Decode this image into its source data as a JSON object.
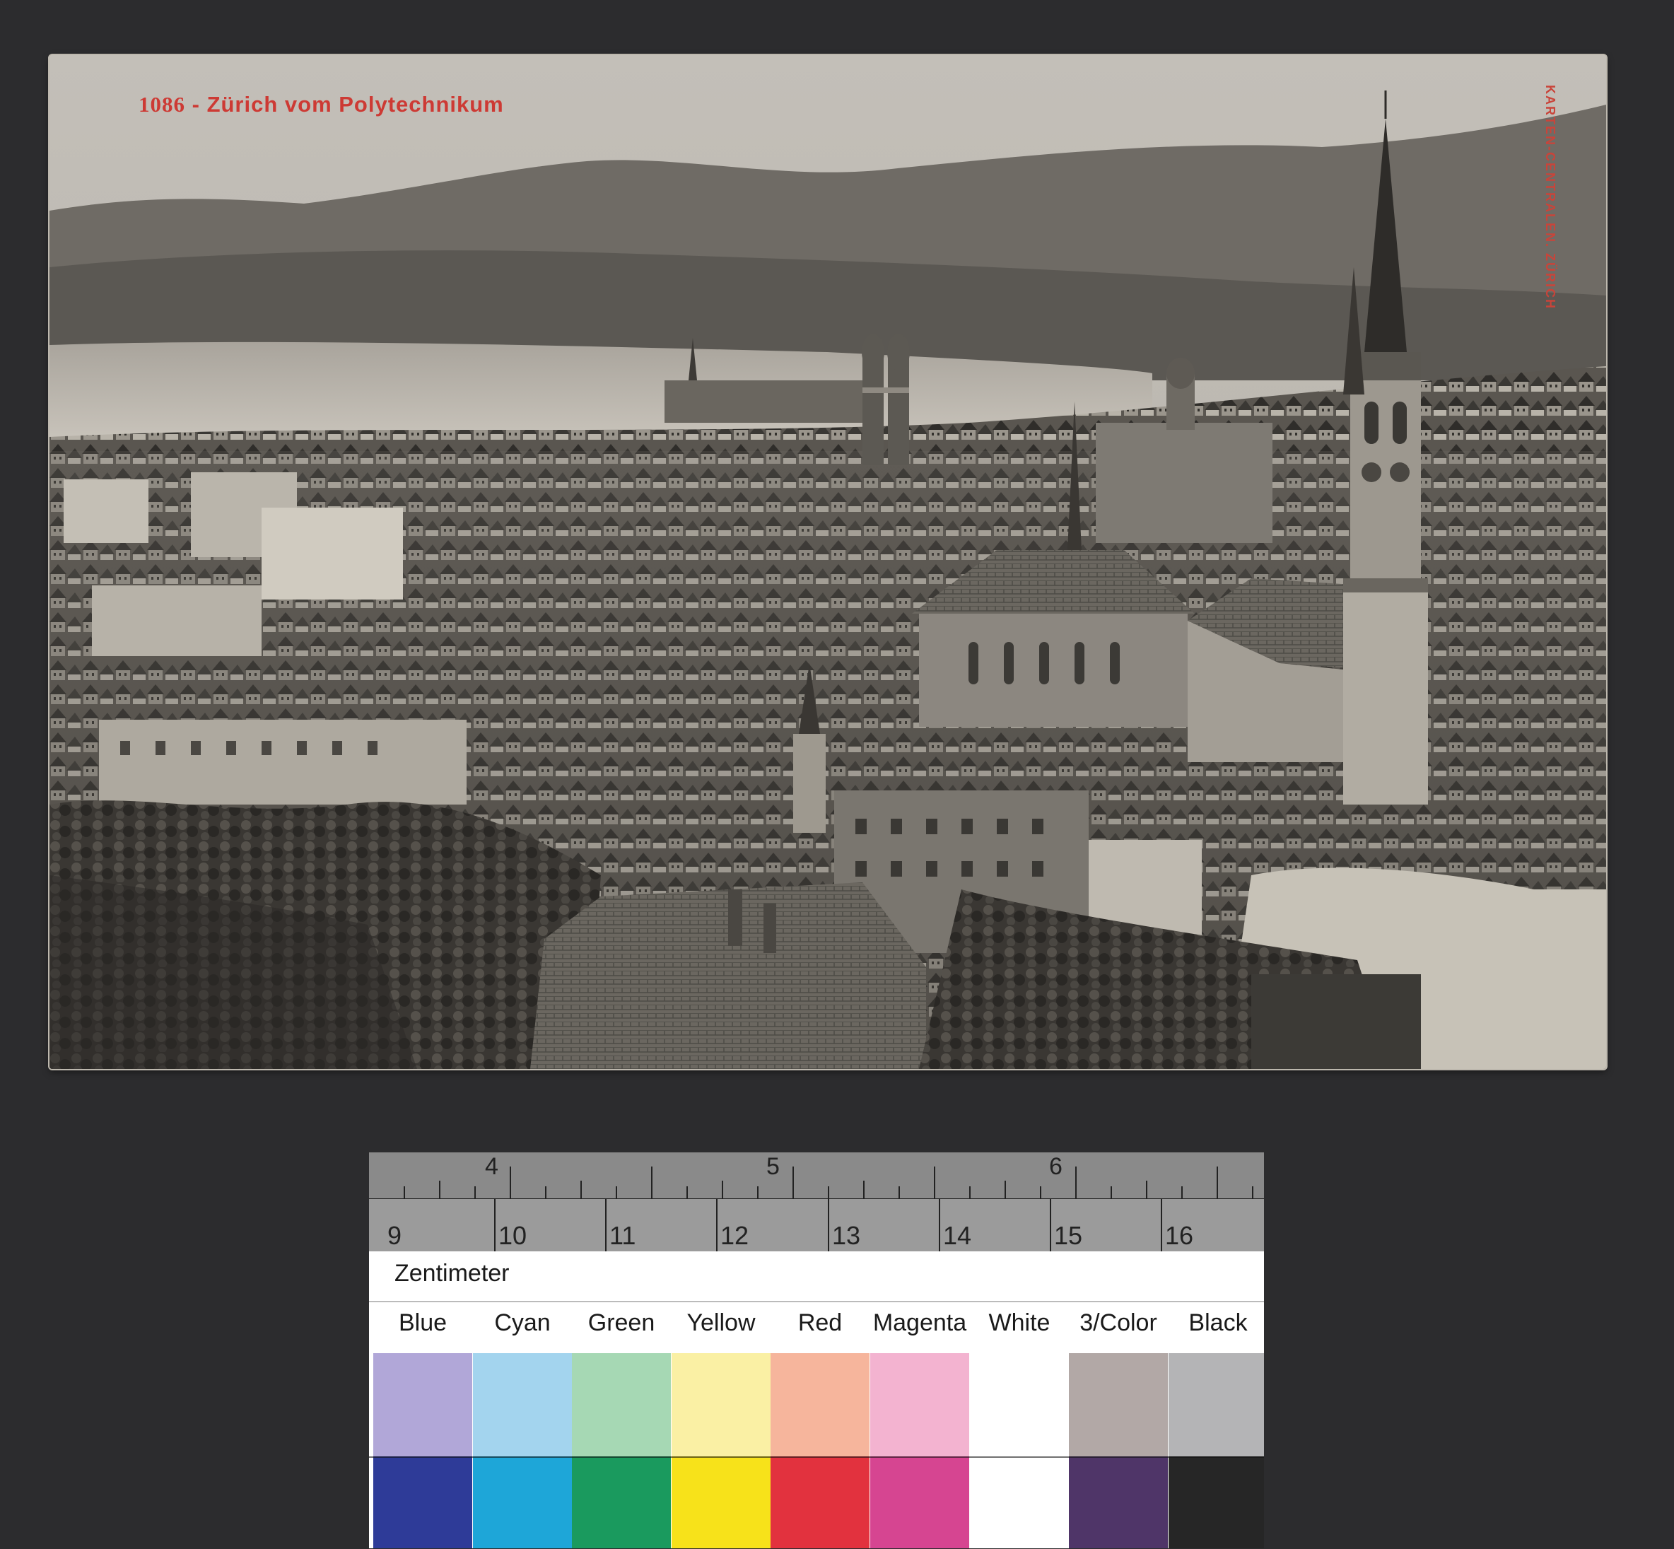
{
  "postcard": {
    "number": "1086",
    "title": "Zürich vom Polytechnikum",
    "publisher": "KARTEN-CENTRALEN. ZÜRICH"
  },
  "colorcard": {
    "ruler_top_labels": [
      "4",
      "5",
      "6"
    ],
    "ruler_bottom_labels": [
      "9",
      "10",
      "11",
      "12",
      "13",
      "14",
      "15",
      "16"
    ],
    "unit_label": "Zentimeter",
    "swatches": [
      {
        "label": "Blue",
        "light": "#b1a7d8",
        "dark": "#2e3b98"
      },
      {
        "label": "Cyan",
        "light": "#a3d4ee",
        "dark": "#1ea6d8"
      },
      {
        "label": "Green",
        "light": "#a6d8b4",
        "dark": "#1a9a5e"
      },
      {
        "label": "Yellow",
        "light": "#faf0a4",
        "dark": "#f7e21a"
      },
      {
        "label": "Red",
        "light": "#f6b59c",
        "dark": "#e2323e"
      },
      {
        "label": "Magenta",
        "light": "#f3b3d0",
        "dark": "#d64591"
      },
      {
        "label": "White",
        "light": "#ffffff",
        "dark": "#ffffff"
      },
      {
        "label": "3/Color",
        "light": "#b2a8a6",
        "dark": "#4f3568"
      },
      {
        "label": "Black",
        "light": "#b4b4b6",
        "dark": "#262626"
      }
    ]
  }
}
